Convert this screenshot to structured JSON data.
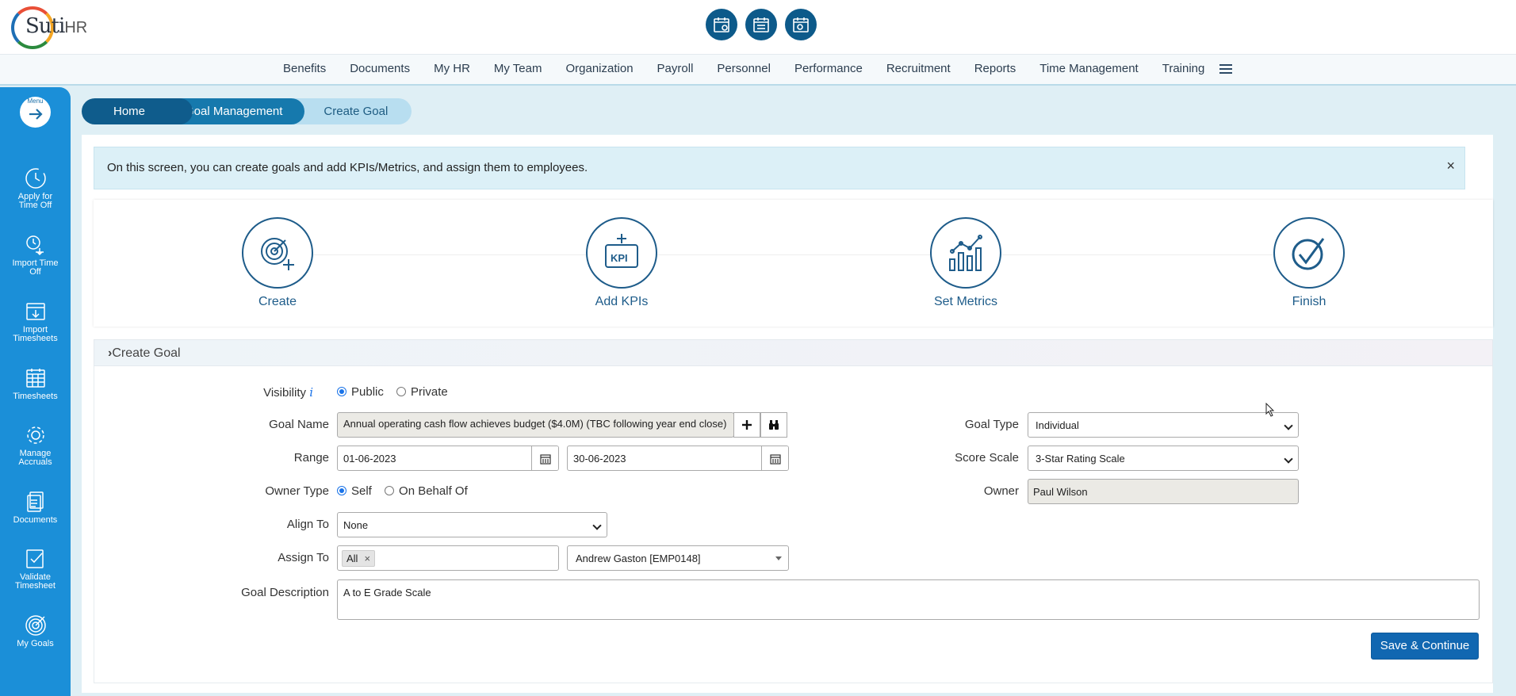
{
  "app": {
    "logo_text": "Suti",
    "logo_suffix": "HR"
  },
  "nav": {
    "items": [
      "Benefits",
      "Documents",
      "My HR",
      "My Team",
      "Organization",
      "Payroll",
      "Personnel",
      "Performance",
      "Recruitment",
      "Reports",
      "Time Management",
      "Training"
    ]
  },
  "sidebar": {
    "menu_label": "Menu",
    "items": [
      {
        "line1": "Apply for",
        "line2": "Time Off",
        "icon": "clock-icon"
      },
      {
        "line1": "Import Time",
        "line2": "Off",
        "icon": "import-time-off-icon"
      },
      {
        "line1": "Import",
        "line2": "Timesheets",
        "icon": "import-timesheets-icon"
      },
      {
        "line1": "Timesheets",
        "line2": "",
        "icon": "calendar-icon"
      },
      {
        "line1": "Manage",
        "line2": "Accruals",
        "icon": "gear-icon"
      },
      {
        "line1": "Documents",
        "line2": "",
        "icon": "documents-icon"
      },
      {
        "line1": "Validate",
        "line2": "Timesheet",
        "icon": "validate-icon"
      },
      {
        "line1": "My Goals",
        "line2": "",
        "icon": "target-icon"
      }
    ]
  },
  "breadcrumb": {
    "home": "Home",
    "goal_management": "Goal Management",
    "current": "Create Goal"
  },
  "info": {
    "message": "On this screen, you can create goals and add KPIs/Metrics, and assign them to employees.",
    "close": "×"
  },
  "steps": {
    "create": "Create",
    "add_kpis": "Add KPIs",
    "set_metrics": "Set Metrics",
    "finish": "Finish"
  },
  "section": {
    "title": "Create Goal"
  },
  "form": {
    "visibility_label": "Visibility",
    "visibility_info": "i",
    "visibility_public": "Public",
    "visibility_private": "Private",
    "goal_name_label": "Goal Name",
    "goal_name_value": "Annual operating cash flow achieves budget ($4.0M) (TBC following year end close)",
    "range_label": "Range",
    "range_from": "01-06-2023",
    "range_to": "30-06-2023",
    "owner_type_label": "Owner Type",
    "owner_type_self": "Self",
    "owner_type_behalf": "On Behalf Of",
    "align_to_label": "Align To",
    "align_to_value": "None",
    "assign_to_label": "Assign To",
    "assign_to_chip": "All",
    "assign_to_chip_remove": "×",
    "assign_to_employee": "Andrew Gaston [EMP0148]",
    "goal_type_label": "Goal Type",
    "goal_type_value": "Individual",
    "score_scale_label": "Score Scale",
    "score_scale_value": "3-Star Rating Scale",
    "owner_label": "Owner",
    "owner_value": "Paul Wilson",
    "description_label": "Goal Description",
    "description_value": "A to E Grade Scale"
  },
  "actions": {
    "save_continue": "Save & Continue"
  },
  "colors": {
    "sidebar": "#1b8fd8",
    "primary": "#1167b1",
    "breadcrumb_home": "#0f5c8c"
  }
}
